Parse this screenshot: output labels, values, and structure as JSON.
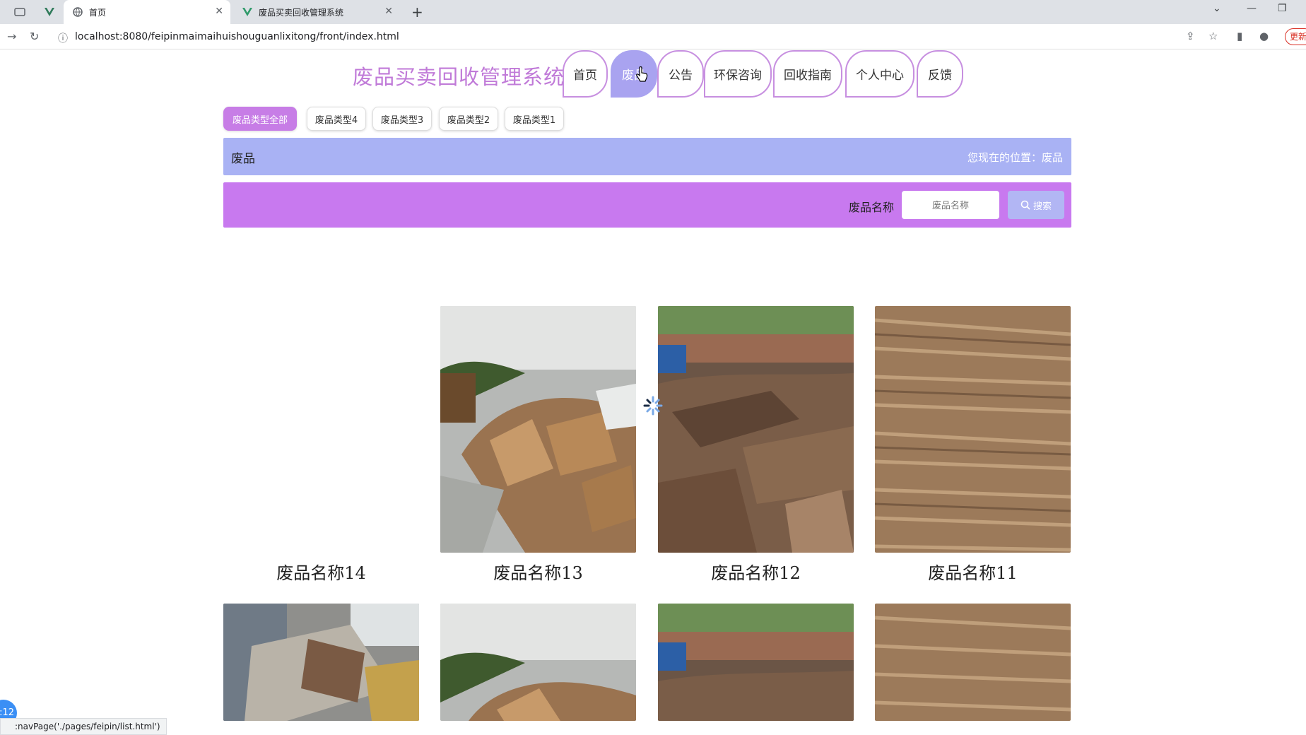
{
  "browser": {
    "tabs": [
      {
        "title": "首页",
        "active": true
      },
      {
        "title": "废品买卖回收管理系统",
        "active": false
      }
    ],
    "url": "localhost:8080/feipinmaimaihuishouguanlixitong/front/index.html",
    "update_label": "更新",
    "status_url": ":navPage('./pages/feipin/list.html')",
    "float_badge": ":12"
  },
  "header": {
    "site_title": "废品买卖回收管理系统",
    "nav": [
      "首页",
      "废品",
      "公告",
      "环保咨询",
      "回收指南",
      "个人中心",
      "反馈"
    ],
    "active_nav": "废品"
  },
  "categories": [
    "废品类型全部",
    "废品类型4",
    "废品类型3",
    "废品类型2",
    "废品类型1"
  ],
  "breadcrumb": {
    "title": "废品",
    "location": "您现在的位置：废品"
  },
  "search": {
    "label": "废品名称",
    "placeholder": "废品名称",
    "button": "搜索"
  },
  "products": [
    {
      "name": "废品名称14",
      "image": "blank"
    },
    {
      "name": "废品名称13",
      "image": "cardboard-pile-cloudy"
    },
    {
      "name": "废品名称12",
      "image": "scrap-metal-yard"
    },
    {
      "name": "废品名称11",
      "image": "flattened-cardboard"
    }
  ],
  "products_row2": [
    {
      "image": "crushed-sheet-metal"
    },
    {
      "image": "cardboard-pile-cloudy"
    },
    {
      "image": "scrap-metal-yard"
    },
    {
      "image": "flattened-cardboard"
    }
  ],
  "colors": {
    "accent_purple": "#c879ef",
    "accent_blue": "#a9b2f4",
    "title_purple": "#c07ad8"
  }
}
